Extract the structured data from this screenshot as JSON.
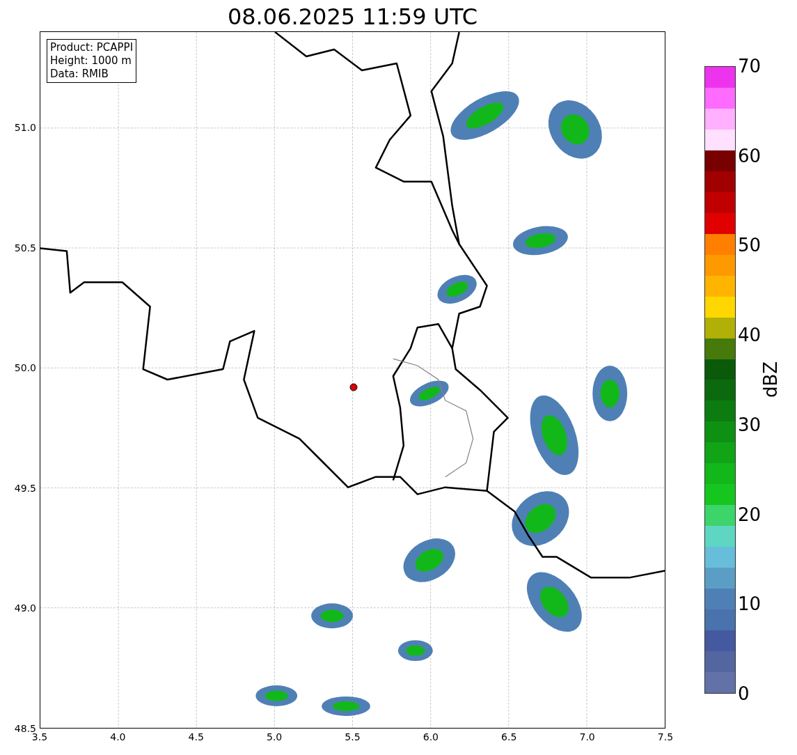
{
  "title": "08.06.2025 11:59 UTC",
  "info_box": [
    "Product: PCAPPI",
    "Height: 1000 m",
    "Data: RMIB"
  ],
  "map": {
    "x_ticks": [
      "3.5",
      "4.0",
      "4.5",
      "5.0",
      "5.5",
      "6.0",
      "6.5",
      "7.0",
      "7.5"
    ],
    "y_ticks": [
      "51.0",
      "50.5",
      "50.0",
      "49.5",
      "49.0",
      "48.5"
    ]
  },
  "colorbar": {
    "label": "dBZ",
    "ticks": [
      "70",
      "60",
      "50",
      "40",
      "30",
      "20",
      "10",
      "0"
    ],
    "bins": [
      {
        "color": "#6272a8"
      },
      {
        "color": "#5466a0"
      },
      {
        "color": "#44599f"
      },
      {
        "color": "#4a72ad"
      },
      {
        "color": "#4f80b5"
      },
      {
        "color": "#5a9ec6"
      },
      {
        "color": "#66bedb"
      },
      {
        "color": "#5fd6c2"
      },
      {
        "color": "#3dd46a"
      },
      {
        "color": "#15c61f"
      },
      {
        "color": "#12b81a"
      },
      {
        "color": "#10a416"
      },
      {
        "color": "#0e9112"
      },
      {
        "color": "#0d7c10"
      },
      {
        "color": "#0a6a0d"
      },
      {
        "color": "#0a5a0a"
      },
      {
        "color": "#467a0a"
      },
      {
        "color": "#b0b007"
      },
      {
        "color": "#ffd700"
      },
      {
        "color": "#ffb400"
      },
      {
        "color": "#ff9900"
      },
      {
        "color": "#ff7f00"
      },
      {
        "color": "#e00000"
      },
      {
        "color": "#c00000"
      },
      {
        "color": "#a00000"
      },
      {
        "color": "#780000"
      },
      {
        "color": "#ffe0ff"
      },
      {
        "color": "#ffb0ff"
      },
      {
        "color": "#ff6bff"
      },
      {
        "color": "#ee33ee"
      }
    ]
  }
}
